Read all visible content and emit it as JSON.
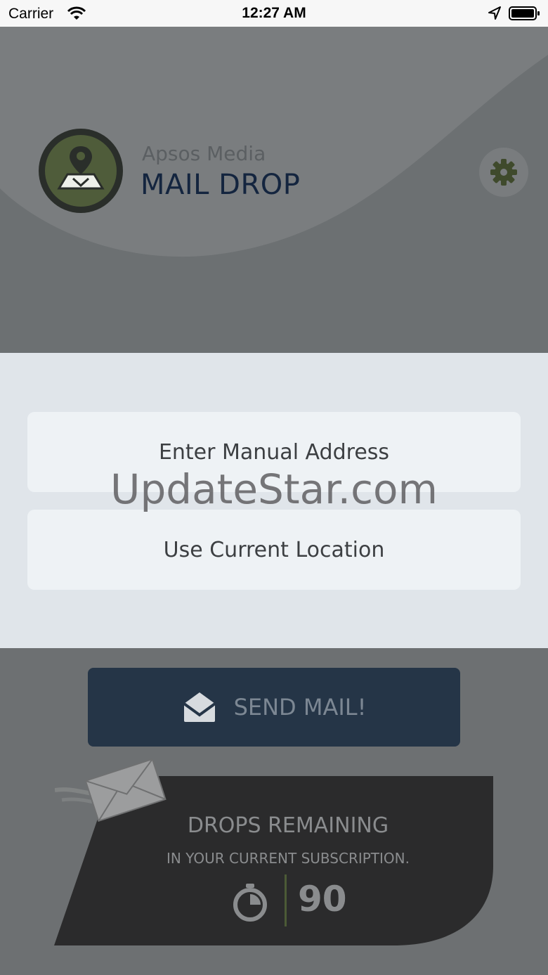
{
  "status_bar": {
    "carrier": "Carrier",
    "time": "12:27 AM"
  },
  "header": {
    "brand_subtitle": "Apsos Media",
    "brand_title": "MAIL DROP",
    "logo_icon": "map-pin-icon",
    "settings_icon": "gear-icon"
  },
  "actions": {
    "manual_address_label": "Enter Manual Address",
    "current_location_label": "Use Current Location"
  },
  "watermark": "UpdateStar.com",
  "send": {
    "label": "SEND MAIL!",
    "icon": "envelope-open-icon"
  },
  "drops": {
    "title": "DROPS REMAINING",
    "subtitle": "IN YOUR CURRENT SUBSCRIPTION.",
    "count": "90",
    "icon": "stopwatch-icon"
  },
  "colors": {
    "brand_title": "#14253f",
    "accent_green": "#4f5c3a",
    "send_button": "#253547"
  }
}
